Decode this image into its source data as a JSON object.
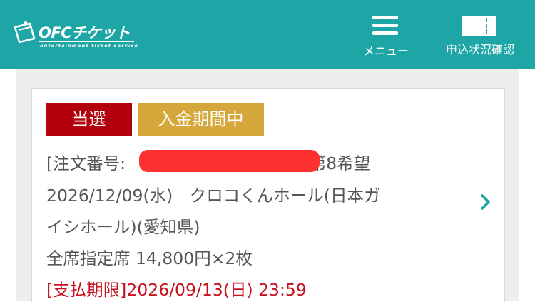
{
  "header": {
    "logo_text": "OFCチケット",
    "logo_tagline": "entertainment ticket service",
    "menu_label": "メニュー",
    "status_label": "申込状況確認",
    "bg_color": "#1ea6a6"
  },
  "order": {
    "status_badge": "当選",
    "payment_badge": "入金期間中",
    "order_prefix": "[注文番号:",
    "order_suffix": "] 第8希望",
    "event_line1": "2026/12/09(水)　クロコくんホール(日本ガ",
    "event_line2": "イシホール)(愛知県)",
    "seat_info": "全席指定席 14,800円×2枚",
    "deadline": "[支払期限]2026/09/13(日) 23:59"
  },
  "colors": {
    "win_badge": "#b3000d",
    "payment_badge": "#d6a73a",
    "deadline_text": "#c8101f",
    "chevron": "#1ea6a6"
  },
  "icons": {
    "menu": "hamburger-icon",
    "status": "ticket-icon",
    "next": "chevron-right-icon"
  }
}
